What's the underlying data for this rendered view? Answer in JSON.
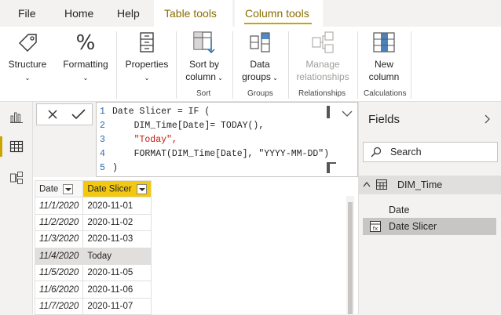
{
  "tabs": {
    "file": "File",
    "home": "Home",
    "help": "Help",
    "table_tools": "Table tools",
    "column_tools": "Column tools"
  },
  "ribbon": {
    "structure": "Structure",
    "formatting": "Formatting",
    "properties": "Properties",
    "sort_line1": "Sort by",
    "sort_line2": "column",
    "data_line1": "Data",
    "data_line2": "groups",
    "manage_line1": "Manage",
    "manage_line2": "relationships",
    "new_line1": "New",
    "new_line2": "column",
    "group_sort": "Sort",
    "group_groups": "Groups",
    "group_relationships": "Relationships",
    "group_calculations": "Calculations"
  },
  "formula": {
    "lines": [
      {
        "n": "1",
        "text": "Date Slicer = IF ("
      },
      {
        "n": "2",
        "text": "    DIM_Time[Date]= TODAY(),"
      },
      {
        "n": "3",
        "text": "    \"Today\","
      },
      {
        "n": "4",
        "text": "    FORMAT(DIM_Time[Date], \"YYYY-MM-DD\")"
      },
      {
        "n": "5",
        "text": ")"
      }
    ]
  },
  "table": {
    "col_date": "Date",
    "col_slicer": "Date Slicer",
    "rows": [
      {
        "date": "11/1/2020",
        "slicer": "2020-11-01"
      },
      {
        "date": "11/2/2020",
        "slicer": "2020-11-02"
      },
      {
        "date": "11/3/2020",
        "slicer": "2020-11-03"
      },
      {
        "date": "11/4/2020",
        "slicer": "Today"
      },
      {
        "date": "11/5/2020",
        "slicer": "2020-11-05"
      },
      {
        "date": "11/6/2020",
        "slicer": "2020-11-06"
      },
      {
        "date": "11/7/2020",
        "slicer": "2020-11-07"
      }
    ]
  },
  "fields": {
    "title": "Fields",
    "search_placeholder": "Search",
    "table_name": "DIM_Time",
    "field_date": "Date",
    "field_slicer": "Date Slicer"
  },
  "colors": {
    "accent": "#f2c811",
    "contextual_tab": "#8a6d00"
  }
}
